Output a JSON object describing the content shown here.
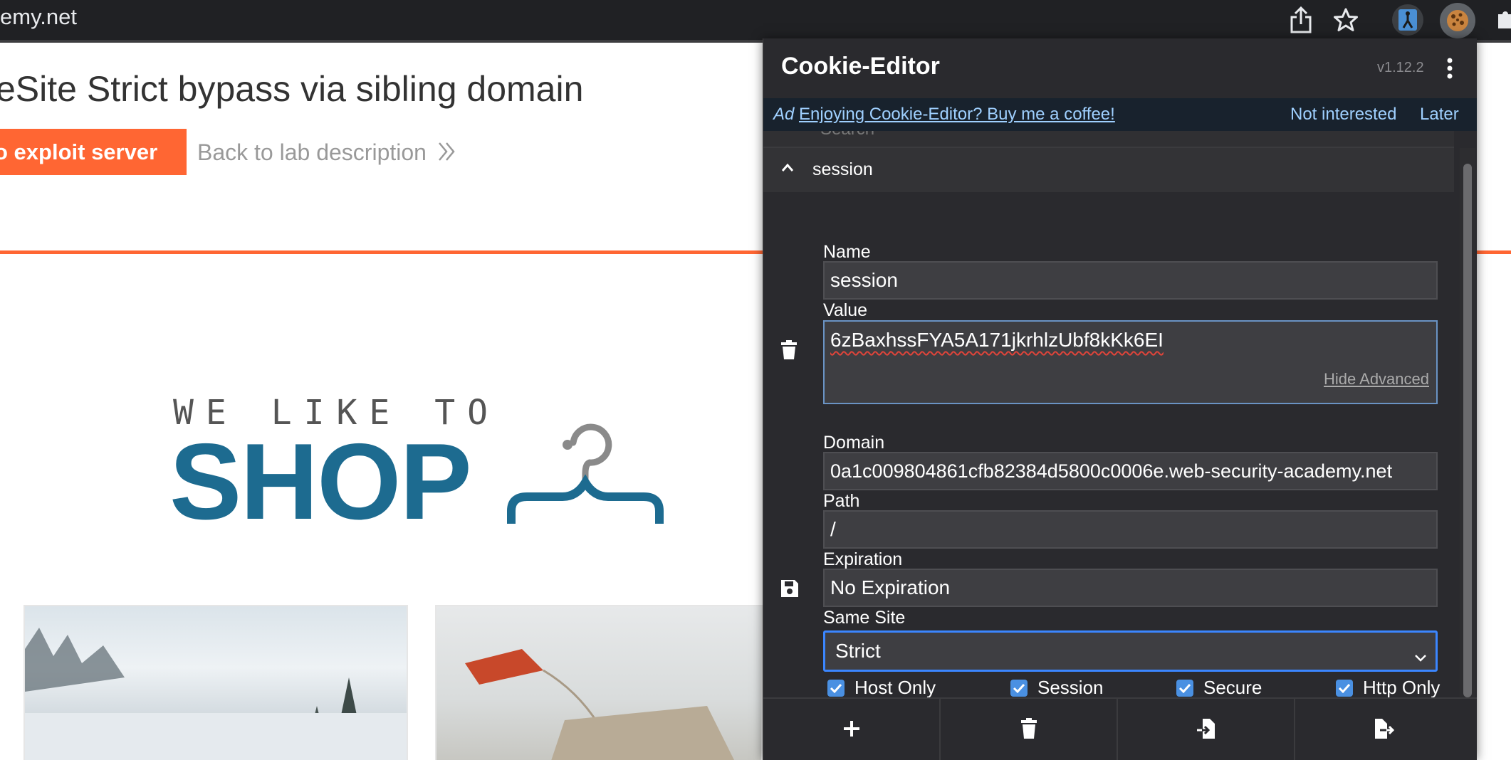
{
  "browser": {
    "url_text": "emy.net",
    "toolbar_icons": [
      "share-icon",
      "bookmark-star-icon",
      "burp-extension-icon",
      "cookie-editor-extension-icon",
      "extensions-puzzle-icon"
    ]
  },
  "page": {
    "title": "eSite Strict bypass via sibling domain",
    "exploit_button": "o exploit server",
    "back_link": "Back to lab description",
    "logo_top": "WE LIKE TO",
    "logo_main": "SHOP",
    "accent_color": "#ff6633",
    "logo_color": "#1d6b90"
  },
  "cookie_editor": {
    "title": "Cookie-Editor",
    "version": "v1.12.2",
    "ad": {
      "label": "Ad",
      "link": "Enjoying Cookie-Editor? Buy me a coffee!",
      "not_interested": "Not interested",
      "later": "Later"
    },
    "search_remnant": "Search",
    "cookie_name_header": "session",
    "fields": {
      "name_label": "Name",
      "name_value": "session",
      "value_label": "Value",
      "value_value": "6zBaxhssFYA5A171jkrhlzUbf8kKk6EI",
      "hide_advanced": "Hide Advanced",
      "domain_label": "Domain",
      "domain_value": "0a1c009804861cfb82384d5800c0006e.web-security-academy.net",
      "path_label": "Path",
      "path_value": "/",
      "expiration_label": "Expiration",
      "expiration_value": "No Expiration",
      "same_site_label": "Same Site",
      "same_site_value": "Strict"
    },
    "checkboxes": {
      "host_only": "Host Only",
      "session": "Session",
      "secure": "Secure",
      "http_only": "Http Only"
    },
    "footer_icons": [
      "add-icon",
      "delete-all-icon",
      "import-icon",
      "export-icon"
    ]
  }
}
